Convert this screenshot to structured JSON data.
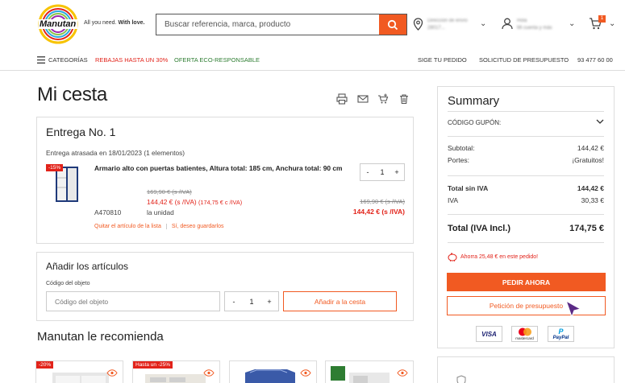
{
  "header": {
    "tagline_plain": "All you need.",
    "tagline_bold": "With love.",
    "search_placeholder": "Buscar referencia, marca, producto",
    "location_line1": "Dirección de envío",
    "location_line2": "28017...",
    "account_line1": "Hola",
    "account_line2": "Mi cuenta y más",
    "cart_count": "1",
    "logo_text": "Manutan"
  },
  "nav": {
    "categories": "CATEGORÍAS",
    "sales": "REBAJAS HASTA UN 30%",
    "eco": "OFERTA ECO-RESPONSABLE",
    "track": "SIGE TU PEDIDO",
    "quote": "SOLICITUD DE PRESUPUESTO",
    "phone": "93 477 60 00"
  },
  "cart": {
    "title": "Mi cesta",
    "delivery_title": "Entrega No. 1",
    "delivery_info": "Entrega atrasada en 18/01/2023 (1 elementos)",
    "item": {
      "discount_badge": "-15%",
      "name": "Armario alto con puertas batientes, Altura total: 185 cm, Anchura total: 90 cm",
      "old_price": "169,90 €  (s /IVA)",
      "price_line": "144,42 €  (s /IVA)",
      "price_incl": "(174,75 € c /IVA)",
      "ref": "A470810",
      "unit": "la unidad",
      "quantity": "1",
      "total_old": "169,90 €  (s /IVA)",
      "total": "144,42 €  (s /IVA)",
      "remove_link": "Quitar el artículo de la lista",
      "save_link": "Sí, deseo guardarlos"
    },
    "add_items": {
      "title": "Añadir los artículos",
      "label": "Código del objeto",
      "placeholder": "Código del objeto",
      "quantity": "1",
      "button": "Añadir a la cesta"
    },
    "recommend_title": "Manutan le recomienda",
    "recommendations": [
      {
        "badge": "-20%"
      },
      {
        "badge": "Hasta un -25%"
      },
      {
        "badge": ""
      },
      {
        "badge": ""
      }
    ]
  },
  "summary": {
    "title": "Summary",
    "coupon": "CÓDIGO GUPÓN:",
    "subtotal_label": "Subtotal:",
    "subtotal_value": "144,42 €",
    "shipping_label": "Portes:",
    "shipping_value": "¡Gratuitos!",
    "total_excl_label": "Total sin IVA",
    "total_excl_value": "144,42 €",
    "iva_label": "IVA",
    "iva_value": "30,33 €",
    "total_label": "Total (IVA Incl.)",
    "total_value": "174,75 €",
    "savings": "Ahorra 25,48 € en este pedido!",
    "pay_button": "PEDIR AHORA",
    "quote_button": "Petición de presupuesto",
    "payments": [
      "VISA",
      "mastercard",
      "PayPal"
    ]
  },
  "colors": {
    "accent": "#f15a22",
    "sale_red": "#e2231a",
    "eco_green": "#2e7d32"
  }
}
